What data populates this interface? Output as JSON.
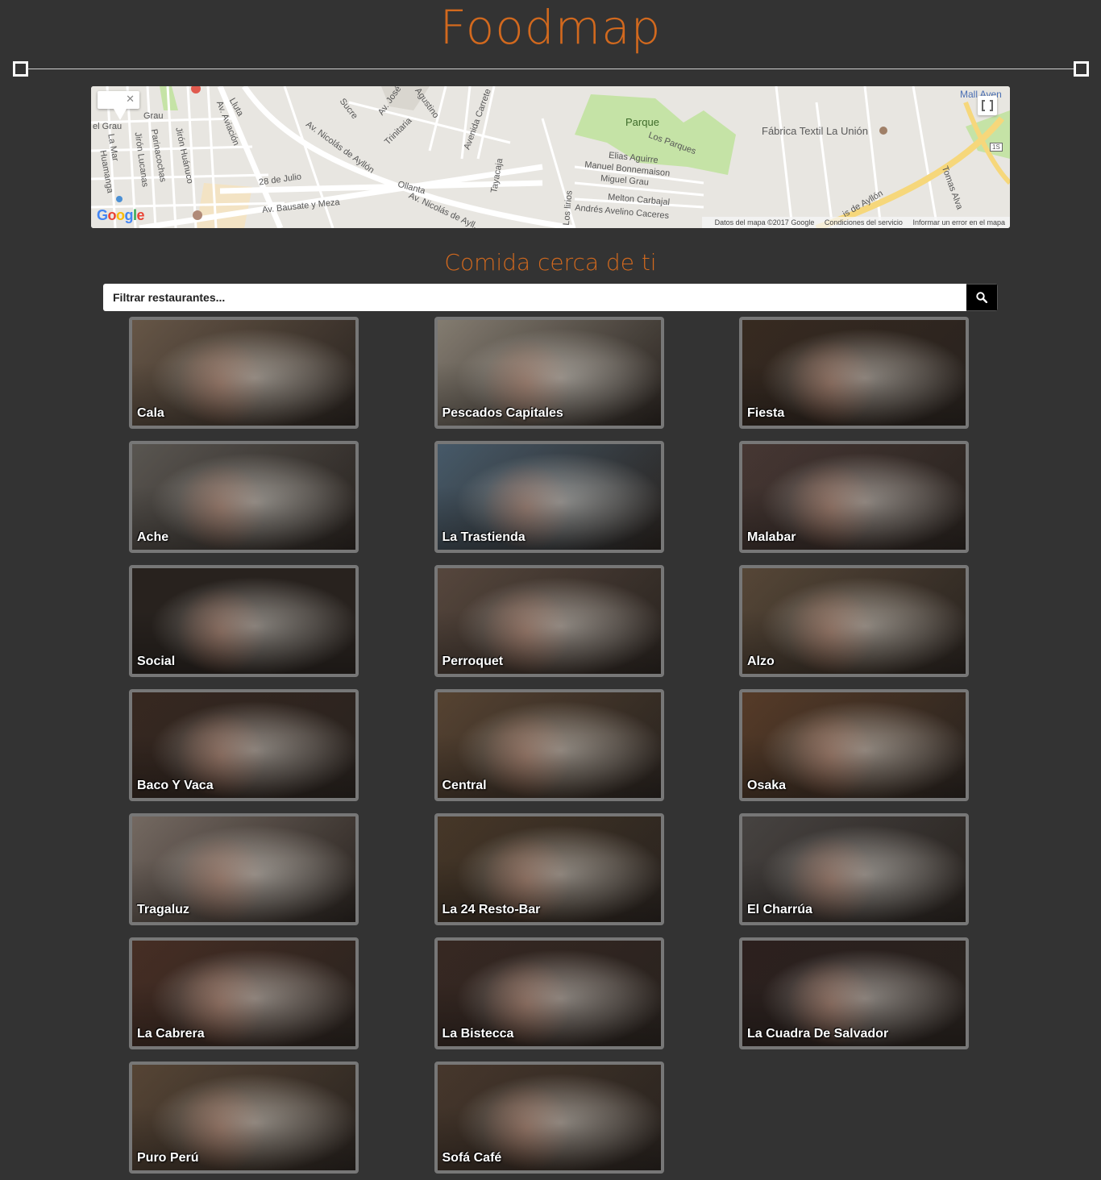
{
  "app": {
    "title": "Foodmap"
  },
  "map": {
    "labels": {
      "grau": "Grau",
      "el_grau": "el Grau",
      "jiron_huanuco": "Jirón Huánuco",
      "av_aviacion": "Av. Aviación",
      "lluta": "Lluta",
      "av_nicolas_ayllon": "Av. Nicolás de Ayllón",
      "av_nicolas_ayllon_2": "Av. Nicolás de Ayll...",
      "sucre": "Sucre",
      "av_jose": "Av. José",
      "agustino": "Agustino",
      "avenida_carrete": "Avenida Carrete",
      "trinitaria": "Trinitaria",
      "parque": "Parque",
      "los_parques": "Los Parques",
      "elias_aguirre": "Elias Aguirre",
      "manuel_bonnemaison": "Manuel Bonnemaison",
      "miguel_grau": "Miguel Grau",
      "melton_carbajal": "Melton Carbajal",
      "andres_avelino": "Andrés Avelino Caceres",
      "fabrica_textil": "Fábrica Textil La Unión",
      "mall": "Mall Aven",
      "dejulio": "28 de Julio",
      "ollanta": "Ollanta",
      "tayacaja": "Tayacaja",
      "los_lirios": "Los lirios",
      "av_bausate": "Av. Bausate y Meza",
      "huamanga": "Huamanga",
      "la_mar": "La Mar",
      "jiron_lucanas": "Jirón Lucanas",
      "parinacochas": "Parinacochas",
      "ayllon_right": "is de Ayllón",
      "tomas_alva": "Tomas Alva",
      "route_1s": "1S"
    },
    "attribution": {
      "data": "Datos del mapa ©2017 Google",
      "terms": "Condiciones del servicio",
      "report": "Informar un error en el mapa"
    },
    "google_logo": [
      "G",
      "o",
      "o",
      "g",
      "l",
      "e"
    ]
  },
  "nearby": {
    "title": "Comida cerca de ti",
    "search_placeholder": "Filtrar restaurantes...",
    "search_icon": "search-icon"
  },
  "restaurants": [
    {
      "name": "Cala",
      "color": "#6b5a4a"
    },
    {
      "name": "Pescados Capitales",
      "color": "#8a8276"
    },
    {
      "name": "Fiesta",
      "color": "#3a2c22"
    },
    {
      "name": "Ache",
      "color": "#5e5a55"
    },
    {
      "name": "La Trastienda",
      "color": "#4a5e6e"
    },
    {
      "name": "Malabar",
      "color": "#4a3a36"
    },
    {
      "name": "Social",
      "color": "#2a2420"
    },
    {
      "name": "Perroquet",
      "color": "#5a4a40"
    },
    {
      "name": "Alzo",
      "color": "#5a4a3a"
    },
    {
      "name": "Baco Y Vaca",
      "color": "#3a2a22"
    },
    {
      "name": "Central",
      "color": "#5a4634"
    },
    {
      "name": "Osaka",
      "color": "#5a3e2a"
    },
    {
      "name": "Tragaluz",
      "color": "#7a6e66"
    },
    {
      "name": "La 24 Resto-Bar",
      "color": "#4a3a2a"
    },
    {
      "name": "El Charrúa",
      "color": "#4a4644"
    },
    {
      "name": "La Cabrera",
      "color": "#4a3026"
    },
    {
      "name": "La Bistecca",
      "color": "#3a2a24"
    },
    {
      "name": "La Cuadra De Salvador",
      "color": "#2e2220"
    },
    {
      "name": "Puro Perú",
      "color": "#5a4838"
    },
    {
      "name": "Sofá Café",
      "color": "#4a3a2e"
    }
  ]
}
